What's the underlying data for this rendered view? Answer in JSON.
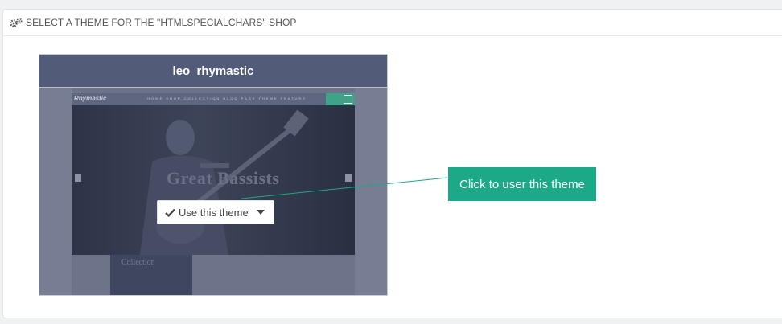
{
  "panel": {
    "heading": "SELECT A THEME FOR THE \"HTMLSPECIALCHARS\" SHOP",
    "heading_icon": "gears-icon"
  },
  "theme": {
    "name": "leo_rhymastic",
    "preview": {
      "logo": "Rhymastic",
      "nav": "HOME SHOP COLLECTION BLOG PAGE THEME FEATURE",
      "headline": "Great Bassists",
      "collection_label": "Collection"
    }
  },
  "actions": {
    "use_label": "Use this theme",
    "use_icon": "check-icon",
    "dropdown_icon": "caret-down-icon"
  },
  "annotation": {
    "callout_text": "Click to user this theme",
    "color": "#1ba987"
  },
  "colors": {
    "accent": "#1ba987",
    "card_header": "#525b77",
    "page_bg": "#eff1f2"
  }
}
